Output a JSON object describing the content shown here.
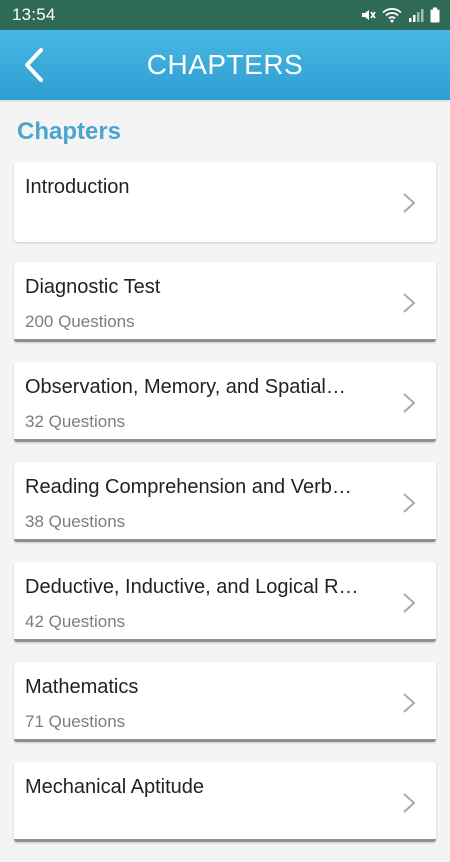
{
  "status_bar": {
    "time": "13:54",
    "icons": [
      "mute-icon",
      "wifi-icon",
      "signal-icon",
      "battery-icon"
    ]
  },
  "app_bar": {
    "title": "CHAPTERS",
    "back_icon": "chevron-left-icon"
  },
  "section": {
    "heading": "Chapters"
  },
  "chapters": [
    {
      "title": "Introduction",
      "subtitle": ""
    },
    {
      "title": "Diagnostic Test",
      "subtitle": "200 Questions"
    },
    {
      "title": "Observation, Memory, and Spatial…",
      "subtitle": "32 Questions"
    },
    {
      "title": "Reading Comprehension and Verb…",
      "subtitle": "38 Questions"
    },
    {
      "title": "Deductive, Inductive, and Logical R…",
      "subtitle": "42 Questions"
    },
    {
      "title": "Mathematics",
      "subtitle": "71 Questions"
    },
    {
      "title": "Mechanical Aptitude",
      "subtitle": ""
    }
  ],
  "colors": {
    "status_bar": "#2f6a57",
    "app_bar": "#3aaadd",
    "heading": "#4ba6cf",
    "background": "#f4f4f4"
  }
}
